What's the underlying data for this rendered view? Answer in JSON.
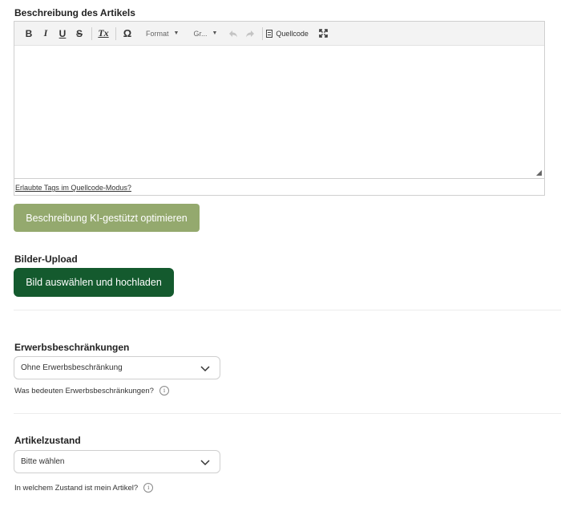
{
  "description": {
    "label": "Beschreibung des Artikels",
    "toolbar": {
      "bold": "B",
      "italic": "I",
      "underline": "U",
      "strike": "S",
      "clear_format": "Tx",
      "special_char": "Ω",
      "format": "Format",
      "size": "Gr...",
      "source": "Quellcode"
    },
    "help_link": "Erlaubte Tags im Quellcode-Modus?"
  },
  "ki_button": "Beschreibung KI-gestützt optimieren",
  "images": {
    "label": "Bilder-Upload",
    "button": "Bild auswählen und hochladen"
  },
  "restrictions": {
    "label": "Erwerbsbeschränkungen",
    "selected": "Ohne Erwerbsbeschränkung",
    "hint": "Was bedeuten Erwerbsbeschränkungen?"
  },
  "condition": {
    "label": "Artikelzustand",
    "selected": "Bitte wählen",
    "hint": "In welchem Zustand ist mein Artikel?"
  },
  "icons": {
    "undo": "undo-icon",
    "redo": "redo-icon",
    "source": "source-code-icon",
    "maximize": "maximize-icon",
    "chevron": "chevron-down-icon",
    "info": "info-icon"
  }
}
